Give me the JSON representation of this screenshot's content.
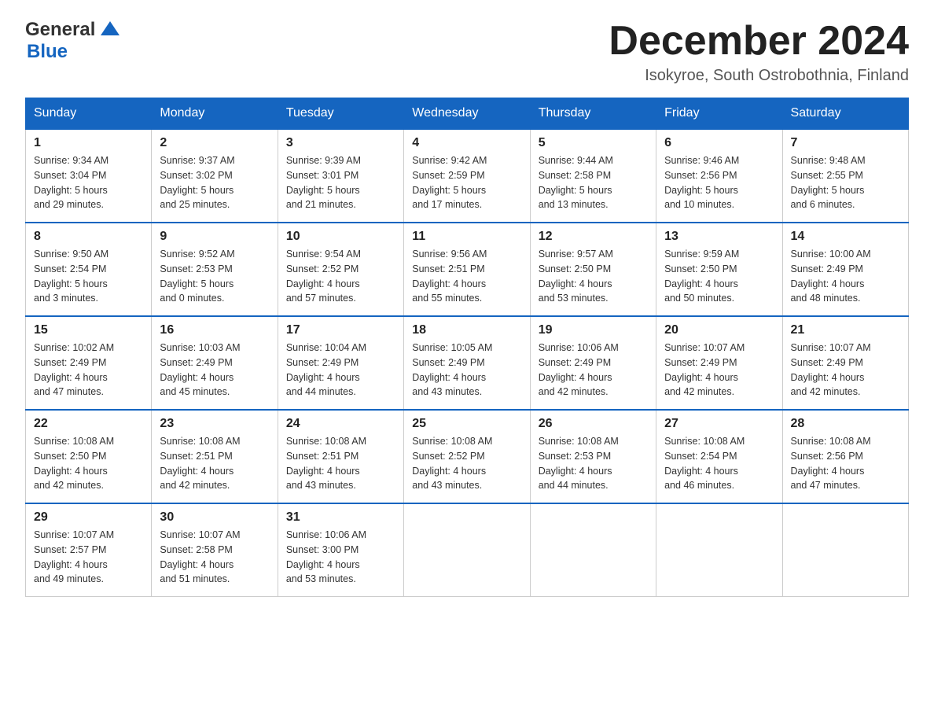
{
  "header": {
    "logo_general": "General",
    "logo_blue": "Blue",
    "month_title": "December 2024",
    "subtitle": "Isokyroe, South Ostrobothnia, Finland"
  },
  "days_of_week": [
    "Sunday",
    "Monday",
    "Tuesday",
    "Wednesday",
    "Thursday",
    "Friday",
    "Saturday"
  ],
  "weeks": [
    [
      {
        "day": "1",
        "sunrise": "9:34 AM",
        "sunset": "3:04 PM",
        "daylight": "5 hours and 29 minutes."
      },
      {
        "day": "2",
        "sunrise": "9:37 AM",
        "sunset": "3:02 PM",
        "daylight": "5 hours and 25 minutes."
      },
      {
        "day": "3",
        "sunrise": "9:39 AM",
        "sunset": "3:01 PM",
        "daylight": "5 hours and 21 minutes."
      },
      {
        "day": "4",
        "sunrise": "9:42 AM",
        "sunset": "2:59 PM",
        "daylight": "5 hours and 17 minutes."
      },
      {
        "day": "5",
        "sunrise": "9:44 AM",
        "sunset": "2:58 PM",
        "daylight": "5 hours and 13 minutes."
      },
      {
        "day": "6",
        "sunrise": "9:46 AM",
        "sunset": "2:56 PM",
        "daylight": "5 hours and 10 minutes."
      },
      {
        "day": "7",
        "sunrise": "9:48 AM",
        "sunset": "2:55 PM",
        "daylight": "5 hours and 6 minutes."
      }
    ],
    [
      {
        "day": "8",
        "sunrise": "9:50 AM",
        "sunset": "2:54 PM",
        "daylight": "5 hours and 3 minutes."
      },
      {
        "day": "9",
        "sunrise": "9:52 AM",
        "sunset": "2:53 PM",
        "daylight": "5 hours and 0 minutes."
      },
      {
        "day": "10",
        "sunrise": "9:54 AM",
        "sunset": "2:52 PM",
        "daylight": "4 hours and 57 minutes."
      },
      {
        "day": "11",
        "sunrise": "9:56 AM",
        "sunset": "2:51 PM",
        "daylight": "4 hours and 55 minutes."
      },
      {
        "day": "12",
        "sunrise": "9:57 AM",
        "sunset": "2:50 PM",
        "daylight": "4 hours and 53 minutes."
      },
      {
        "day": "13",
        "sunrise": "9:59 AM",
        "sunset": "2:50 PM",
        "daylight": "4 hours and 50 minutes."
      },
      {
        "day": "14",
        "sunrise": "10:00 AM",
        "sunset": "2:49 PM",
        "daylight": "4 hours and 48 minutes."
      }
    ],
    [
      {
        "day": "15",
        "sunrise": "10:02 AM",
        "sunset": "2:49 PM",
        "daylight": "4 hours and 47 minutes."
      },
      {
        "day": "16",
        "sunrise": "10:03 AM",
        "sunset": "2:49 PM",
        "daylight": "4 hours and 45 minutes."
      },
      {
        "day": "17",
        "sunrise": "10:04 AM",
        "sunset": "2:49 PM",
        "daylight": "4 hours and 44 minutes."
      },
      {
        "day": "18",
        "sunrise": "10:05 AM",
        "sunset": "2:49 PM",
        "daylight": "4 hours and 43 minutes."
      },
      {
        "day": "19",
        "sunrise": "10:06 AM",
        "sunset": "2:49 PM",
        "daylight": "4 hours and 42 minutes."
      },
      {
        "day": "20",
        "sunrise": "10:07 AM",
        "sunset": "2:49 PM",
        "daylight": "4 hours and 42 minutes."
      },
      {
        "day": "21",
        "sunrise": "10:07 AM",
        "sunset": "2:49 PM",
        "daylight": "4 hours and 42 minutes."
      }
    ],
    [
      {
        "day": "22",
        "sunrise": "10:08 AM",
        "sunset": "2:50 PM",
        "daylight": "4 hours and 42 minutes."
      },
      {
        "day": "23",
        "sunrise": "10:08 AM",
        "sunset": "2:51 PM",
        "daylight": "4 hours and 42 minutes."
      },
      {
        "day": "24",
        "sunrise": "10:08 AM",
        "sunset": "2:51 PM",
        "daylight": "4 hours and 43 minutes."
      },
      {
        "day": "25",
        "sunrise": "10:08 AM",
        "sunset": "2:52 PM",
        "daylight": "4 hours and 43 minutes."
      },
      {
        "day": "26",
        "sunrise": "10:08 AM",
        "sunset": "2:53 PM",
        "daylight": "4 hours and 44 minutes."
      },
      {
        "day": "27",
        "sunrise": "10:08 AM",
        "sunset": "2:54 PM",
        "daylight": "4 hours and 46 minutes."
      },
      {
        "day": "28",
        "sunrise": "10:08 AM",
        "sunset": "2:56 PM",
        "daylight": "4 hours and 47 minutes."
      }
    ],
    [
      {
        "day": "29",
        "sunrise": "10:07 AM",
        "sunset": "2:57 PM",
        "daylight": "4 hours and 49 minutes."
      },
      {
        "day": "30",
        "sunrise": "10:07 AM",
        "sunset": "2:58 PM",
        "daylight": "4 hours and 51 minutes."
      },
      {
        "day": "31",
        "sunrise": "10:06 AM",
        "sunset": "3:00 PM",
        "daylight": "4 hours and 53 minutes."
      },
      null,
      null,
      null,
      null
    ]
  ],
  "labels": {
    "sunrise": "Sunrise:",
    "sunset": "Sunset:",
    "daylight": "Daylight:"
  }
}
